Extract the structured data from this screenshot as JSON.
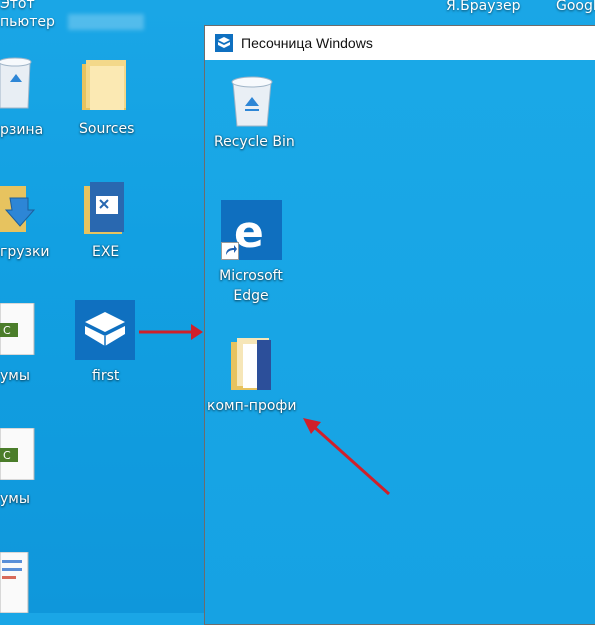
{
  "desktop": {
    "top_labels": [
      "Этот",
      "пьютер",
      "Я.Браузер",
      "Googl"
    ],
    "icons": [
      {
        "label": "рзина"
      },
      {
        "label": "Sources"
      },
      {
        "label": "грузки"
      },
      {
        "label": "EXE"
      },
      {
        "label": "умы"
      },
      {
        "label": "first"
      },
      {
        "label": "умы"
      }
    ]
  },
  "sandbox_window": {
    "title": "Песочница Windows",
    "icons": [
      {
        "label": "Recycle Bin"
      },
      {
        "label": "Microsoft Edge"
      },
      {
        "label": "комп-профи"
      }
    ]
  },
  "colors": {
    "desktop_bg": "#12a0e2",
    "arrow": "#d0202a",
    "accent_blue": "#0f6fbf"
  }
}
